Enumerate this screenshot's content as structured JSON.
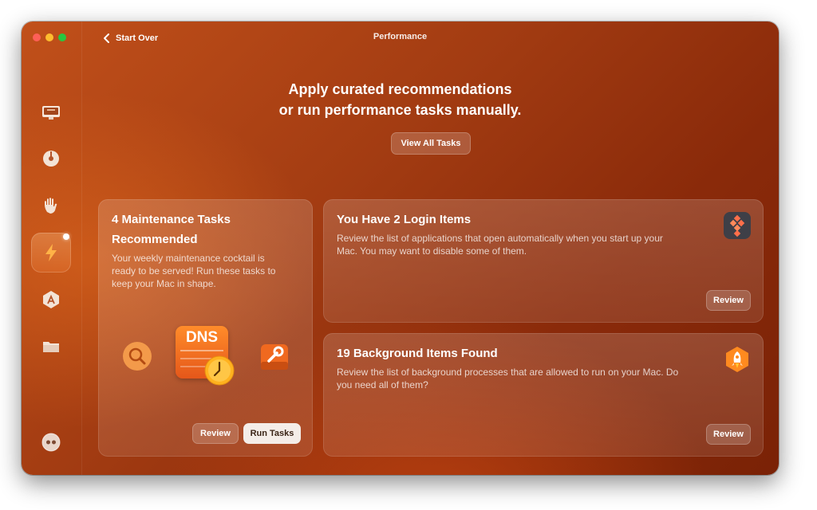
{
  "window": {
    "title": "Performance",
    "back_label": "Start Over"
  },
  "sidebar": {
    "items": [
      {
        "name": "display-icon"
      },
      {
        "name": "disk-icon"
      },
      {
        "name": "hand-icon"
      },
      {
        "name": "lightning-icon",
        "active": true
      },
      {
        "name": "app-store-icon"
      },
      {
        "name": "folder-icon"
      }
    ],
    "bottom_icon": "assistant-icon"
  },
  "header": {
    "line1": "Apply curated recommendations",
    "line2": "or run performance tasks manually.",
    "view_all_label": "View All Tasks"
  },
  "cards": {
    "maintenance": {
      "title_line1": "4 Maintenance Tasks",
      "title_line2": "Recommended",
      "desc_line1": "Your weekly maintenance cocktail is",
      "desc_line2": "ready to be served! Run these tasks to",
      "desc_line3": "keep your Mac in shape.",
      "dns_label": "DNS",
      "review_label": "Review",
      "run_label": "Run Tasks"
    },
    "login": {
      "title": "You Have 2 Login Items",
      "desc_line1": "Review the list of applications that open automatically when you start up your",
      "desc_line2": "Mac. You may want to disable some of them.",
      "review_label": "Review"
    },
    "background": {
      "title": "19 Background Items Found",
      "desc_line1": "Review the list of background processes that are allowed to run on your Mac. Do",
      "desc_line2": "you need all of them?",
      "review_label": "Review"
    }
  },
  "colors": {
    "accent": "#c1501a",
    "close": "#fe5f57",
    "minimize": "#febc2e",
    "maximize": "#28c840"
  }
}
